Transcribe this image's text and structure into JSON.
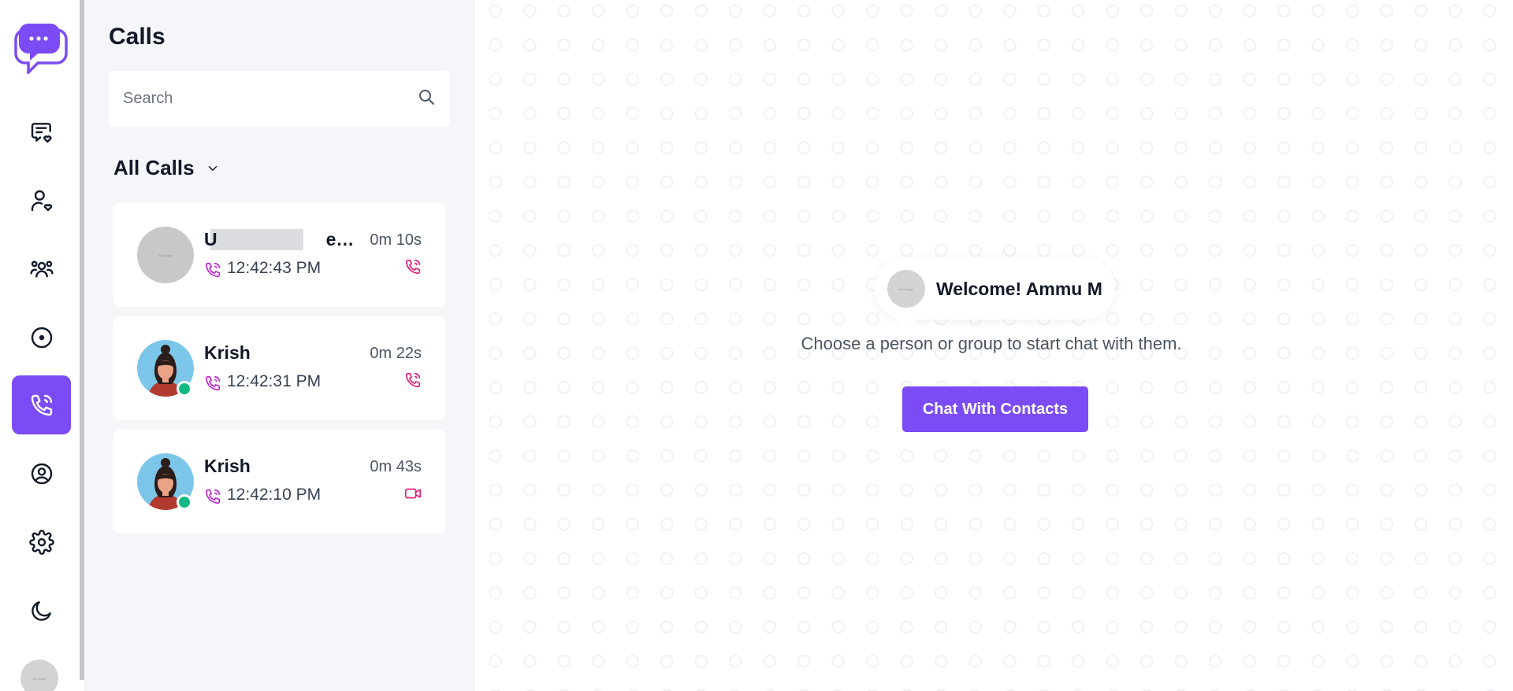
{
  "rail": {
    "items": [
      {
        "name": "chats",
        "icon": "message-heart-icon",
        "active": false
      },
      {
        "name": "contacts",
        "icon": "user-heart-icon",
        "active": false
      },
      {
        "name": "groups",
        "icon": "users-icon",
        "active": false
      },
      {
        "name": "status",
        "icon": "status-circle-icon",
        "active": false
      },
      {
        "name": "calls",
        "icon": "phone-call-icon",
        "active": true
      },
      {
        "name": "profile",
        "icon": "user-circle-icon",
        "active": false
      },
      {
        "name": "settings",
        "icon": "gear-icon",
        "active": false
      },
      {
        "name": "theme",
        "icon": "moon-icon",
        "active": false
      }
    ],
    "avatar_text": "No Image"
  },
  "calls": {
    "title": "Calls",
    "search_placeholder": "Search",
    "filter_label": "All Calls",
    "items": [
      {
        "name": "U      ecei...",
        "duration": "0m 10s",
        "time": "12:42:43 PM",
        "avatar_text": "No Image",
        "online": false,
        "type_icon": "phone-incoming-icon"
      },
      {
        "name": "Krish",
        "duration": "0m 22s",
        "time": "12:42:31 PM",
        "online": true,
        "type_icon": "phone-incoming-icon"
      },
      {
        "name": "Krish",
        "duration": "0m 43s",
        "time": "12:42:10 PM",
        "online": true,
        "type_icon": "video-icon"
      }
    ]
  },
  "welcome": {
    "greeting": "Welcome! Ammu M",
    "avatar_text": "No Image",
    "subtitle": "Choose a person or group to start chat with them.",
    "cta_label": "Chat With Contacts"
  },
  "colors": {
    "accent": "#7b4cf5",
    "online": "#10b981",
    "call_icon": "#c026d3"
  }
}
